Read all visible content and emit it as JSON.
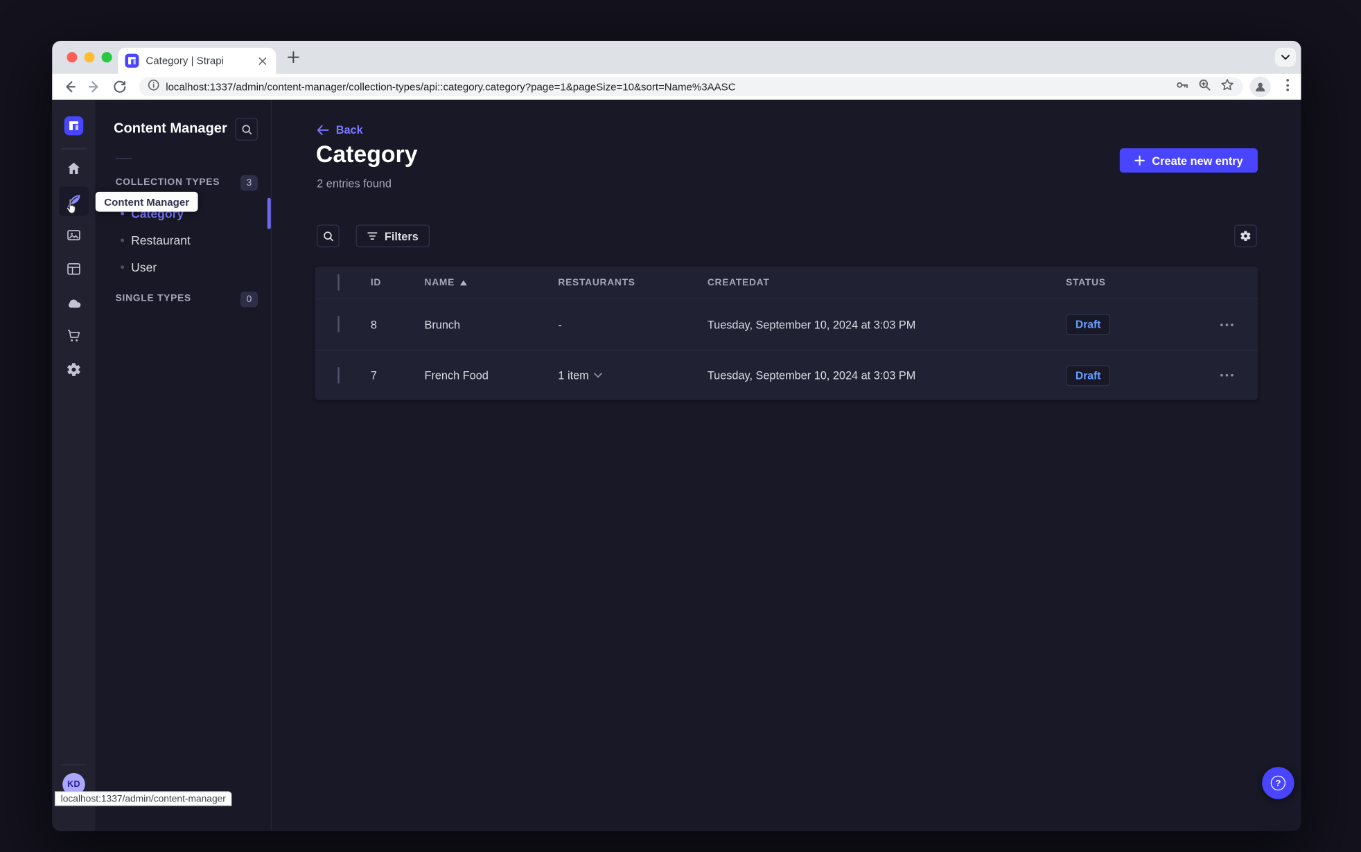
{
  "browser": {
    "tab_title": "Category | Strapi",
    "url": "localhost:1337/admin/content-manager/collection-types/api::category.category?page=1&pageSize=10&sort=Name%3AASC",
    "status_tooltip": "localhost:1337/admin/content-manager"
  },
  "rail": {
    "items": [
      {
        "name": "home"
      },
      {
        "name": "content-manager",
        "active": true
      },
      {
        "name": "media-library"
      },
      {
        "name": "content-type-builder"
      },
      {
        "name": "deploy"
      },
      {
        "name": "marketplace"
      },
      {
        "name": "settings"
      }
    ],
    "avatar_initials": "KD",
    "tooltip": "Content Manager"
  },
  "subnav": {
    "title": "Content Manager",
    "sections": [
      {
        "label": "COLLECTION TYPES",
        "badge": "3",
        "items": [
          {
            "label": "Category",
            "active": true
          },
          {
            "label": "Restaurant",
            "active": false
          },
          {
            "label": "User",
            "active": false
          }
        ]
      },
      {
        "label": "SINGLE TYPES",
        "badge": "0",
        "items": []
      }
    ]
  },
  "content": {
    "back": "Back",
    "title": "Category",
    "subtitle": "2 entries found",
    "create_button": "Create new entry",
    "filters_button": "Filters"
  },
  "table": {
    "headers": [
      "ID",
      "NAME",
      "RESTAURANTS",
      "CREATEDAT",
      "STATUS"
    ],
    "rows": [
      {
        "id": "8",
        "name": "Brunch",
        "restaurants": "-",
        "createdat": "Tuesday, September 10, 2024 at 3:03 PM",
        "status": "Draft"
      },
      {
        "id": "7",
        "name": "French Food",
        "restaurants": "1 item",
        "createdat": "Tuesday, September 10, 2024 at 3:03 PM",
        "status": "Draft"
      }
    ]
  },
  "icons": {
    "help_glyph": "?",
    "search": "magnifier",
    "filters": "funnel-lines",
    "settings": "gear",
    "sort": "triangle-up",
    "more_actions": "ellipsis"
  },
  "colors": {
    "primary": "#4945ff",
    "accent_text": "#7b79ff",
    "draft_text": "#6b9dff",
    "surface": "#212134",
    "background": "#181826"
  }
}
